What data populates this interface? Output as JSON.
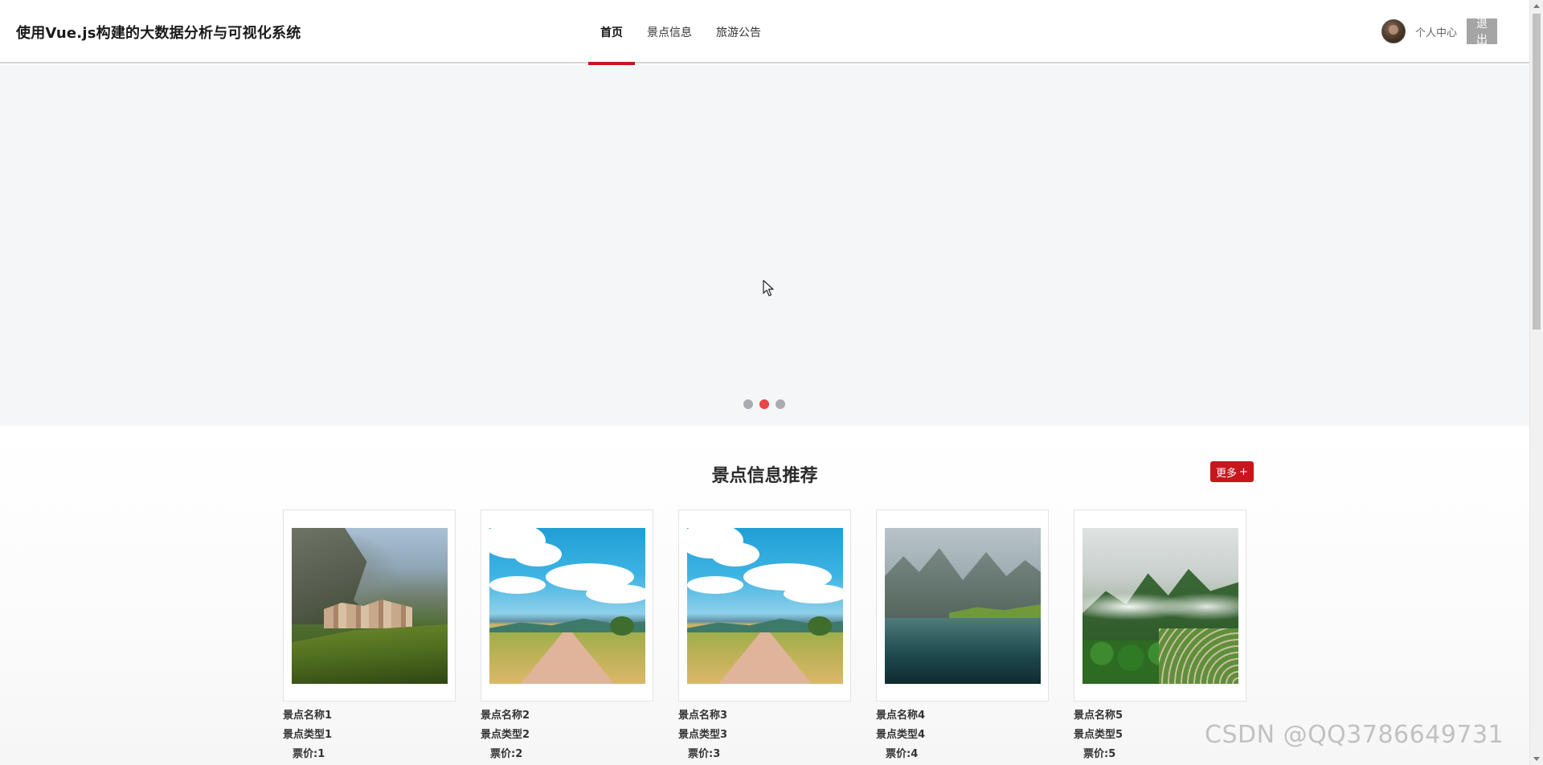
{
  "header": {
    "title": "使用Vue.js构建的大数据分析与可视化系统",
    "nav": [
      {
        "label": "首页",
        "active": true
      },
      {
        "label": "景点信息",
        "active": false
      },
      {
        "label": "旅游公告",
        "active": false
      }
    ],
    "user": {
      "profile_label": "个人中心",
      "logout_label": "退出"
    }
  },
  "carousel": {
    "slide_count": 3,
    "active_index": 1
  },
  "section": {
    "title": "景点信息推荐",
    "more_label": "更多",
    "more_icon": "+",
    "cards": [
      {
        "name": "景点名称1",
        "type": "景点类型1",
        "price": "票价:1",
        "image": "cliff-village"
      },
      {
        "name": "景点名称2",
        "type": "景点类型2",
        "price": "票价:2",
        "image": "country-road-clouds"
      },
      {
        "name": "景点名称3",
        "type": "景点类型3",
        "price": "票价:3",
        "image": "country-road-clouds"
      },
      {
        "name": "景点名称4",
        "type": "景点类型4",
        "price": "票价:4",
        "image": "karst-lake"
      },
      {
        "name": "景点名称5",
        "type": "景点类型5",
        "price": "票价:5",
        "image": "misty-mountains"
      }
    ]
  },
  "watermark": "CSDN @QQ3786649731",
  "colors": {
    "accent": "#c8161d",
    "active_dot": "#e84545",
    "inactive_dot": "#a9abb0",
    "logout_bg": "#a5a5a5",
    "banner_bg": "#f5f6f8"
  }
}
